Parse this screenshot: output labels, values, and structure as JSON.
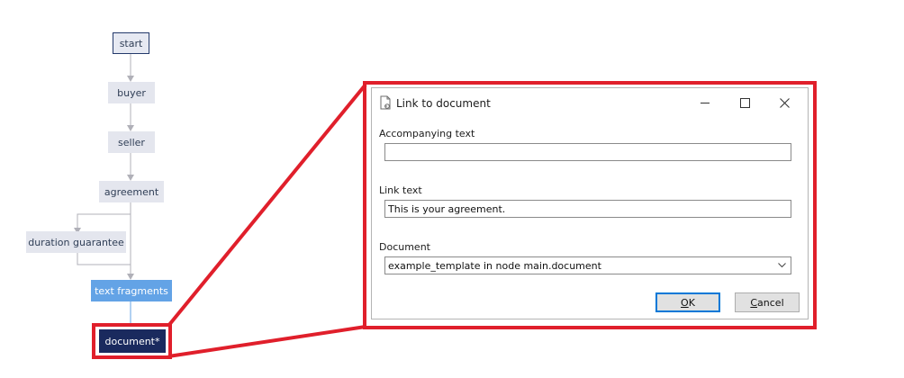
{
  "flow": {
    "nodes": {
      "start": "start",
      "buyer": "buyer",
      "seller": "seller",
      "agreement": "agreement",
      "duration": "duration guarantee",
      "fragments": "text fragments",
      "document": "document*"
    }
  },
  "dialog": {
    "title": "Link to document",
    "accompanying_label": "Accompanying text",
    "accompanying_value": "",
    "link_label": "Link text",
    "link_value": "This is your agreement.",
    "document_label": "Document",
    "document_value": "example_template in node main.document",
    "ok_mnemonic": "O",
    "ok_rest": "K",
    "cancel_mnemonic": "C",
    "cancel_rest": "ancel"
  },
  "colors": {
    "highlight": "#e01f2b",
    "node_selected": "#1a2a5e",
    "node_active": "#63a3e6"
  }
}
